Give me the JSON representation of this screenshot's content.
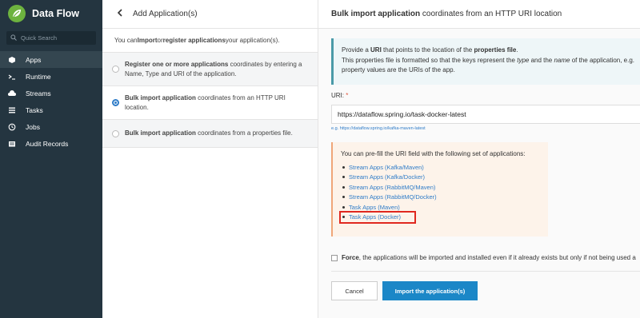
{
  "brand": {
    "name": "Data Flow"
  },
  "search": {
    "placeholder": "Quick Search"
  },
  "nav": [
    {
      "label": "Apps",
      "icon": "cube-icon",
      "active": true
    },
    {
      "label": "Runtime",
      "icon": "terminal-icon"
    },
    {
      "label": "Streams",
      "icon": "cloud-icon"
    },
    {
      "label": "Tasks",
      "icon": "list-icon"
    },
    {
      "label": "Jobs",
      "icon": "clock-icon"
    },
    {
      "label": "Audit Records",
      "icon": "audit-icon"
    }
  ],
  "middle": {
    "title": "Add Application(s)",
    "intro_pre": "You can ",
    "intro_b1": "Import",
    "intro_mid": " or ",
    "intro_b2": "register applications",
    "intro_post": " your application(s).",
    "options": [
      {
        "bold": "Register one or more applications",
        "text": " coordinates by entering a Name, Type and URI of the application."
      },
      {
        "bold": "Bulk import application",
        "text": " coordinates from an HTTP URI location."
      },
      {
        "bold": "Bulk import application",
        "text": " coordinates from a properties file."
      }
    ]
  },
  "right": {
    "title_bold": "Bulk import application",
    "title_rest": " coordinates from an HTTP URI location",
    "info_line1_pre": "Provide a ",
    "info_line1_b1": "URI",
    "info_line1_mid": " that points to the location of the ",
    "info_line1_b2": "properties file",
    "info_line1_post": ".",
    "info_line2_pre": "This properties file is formatted so that the keys represent the ",
    "info_line2_i1": "type",
    "info_line2_mid": " and the ",
    "info_line2_i2": "name",
    "info_line2_post": " of the application, e.g.",
    "info_line3": "property values are the URIs of the app.",
    "uri_label": "URI:",
    "uri_required": "*",
    "uri_value": "https://dataflow.spring.io/task-docker-latest",
    "uri_hint": "e.g. https://dataflow.spring.io/kafka-maven-latest",
    "prefill_title": "You can pre-fill the URI field with the following set of applications:",
    "prefill_items": [
      "Stream Apps (Kafka/Maven)",
      "Stream Apps (Kafka/Docker)",
      "Stream Apps (RabbitMQ/Maven)",
      "Stream Apps (RabbitMQ/Docker)",
      "Task Apps (Maven)",
      "Task Apps (Docker)"
    ],
    "force_bold": "Force",
    "force_text": ", the applications will be imported and installed even if it already exists but only if not being used a",
    "cancel_label": "Cancel",
    "import_label": "Import the application(s)"
  }
}
